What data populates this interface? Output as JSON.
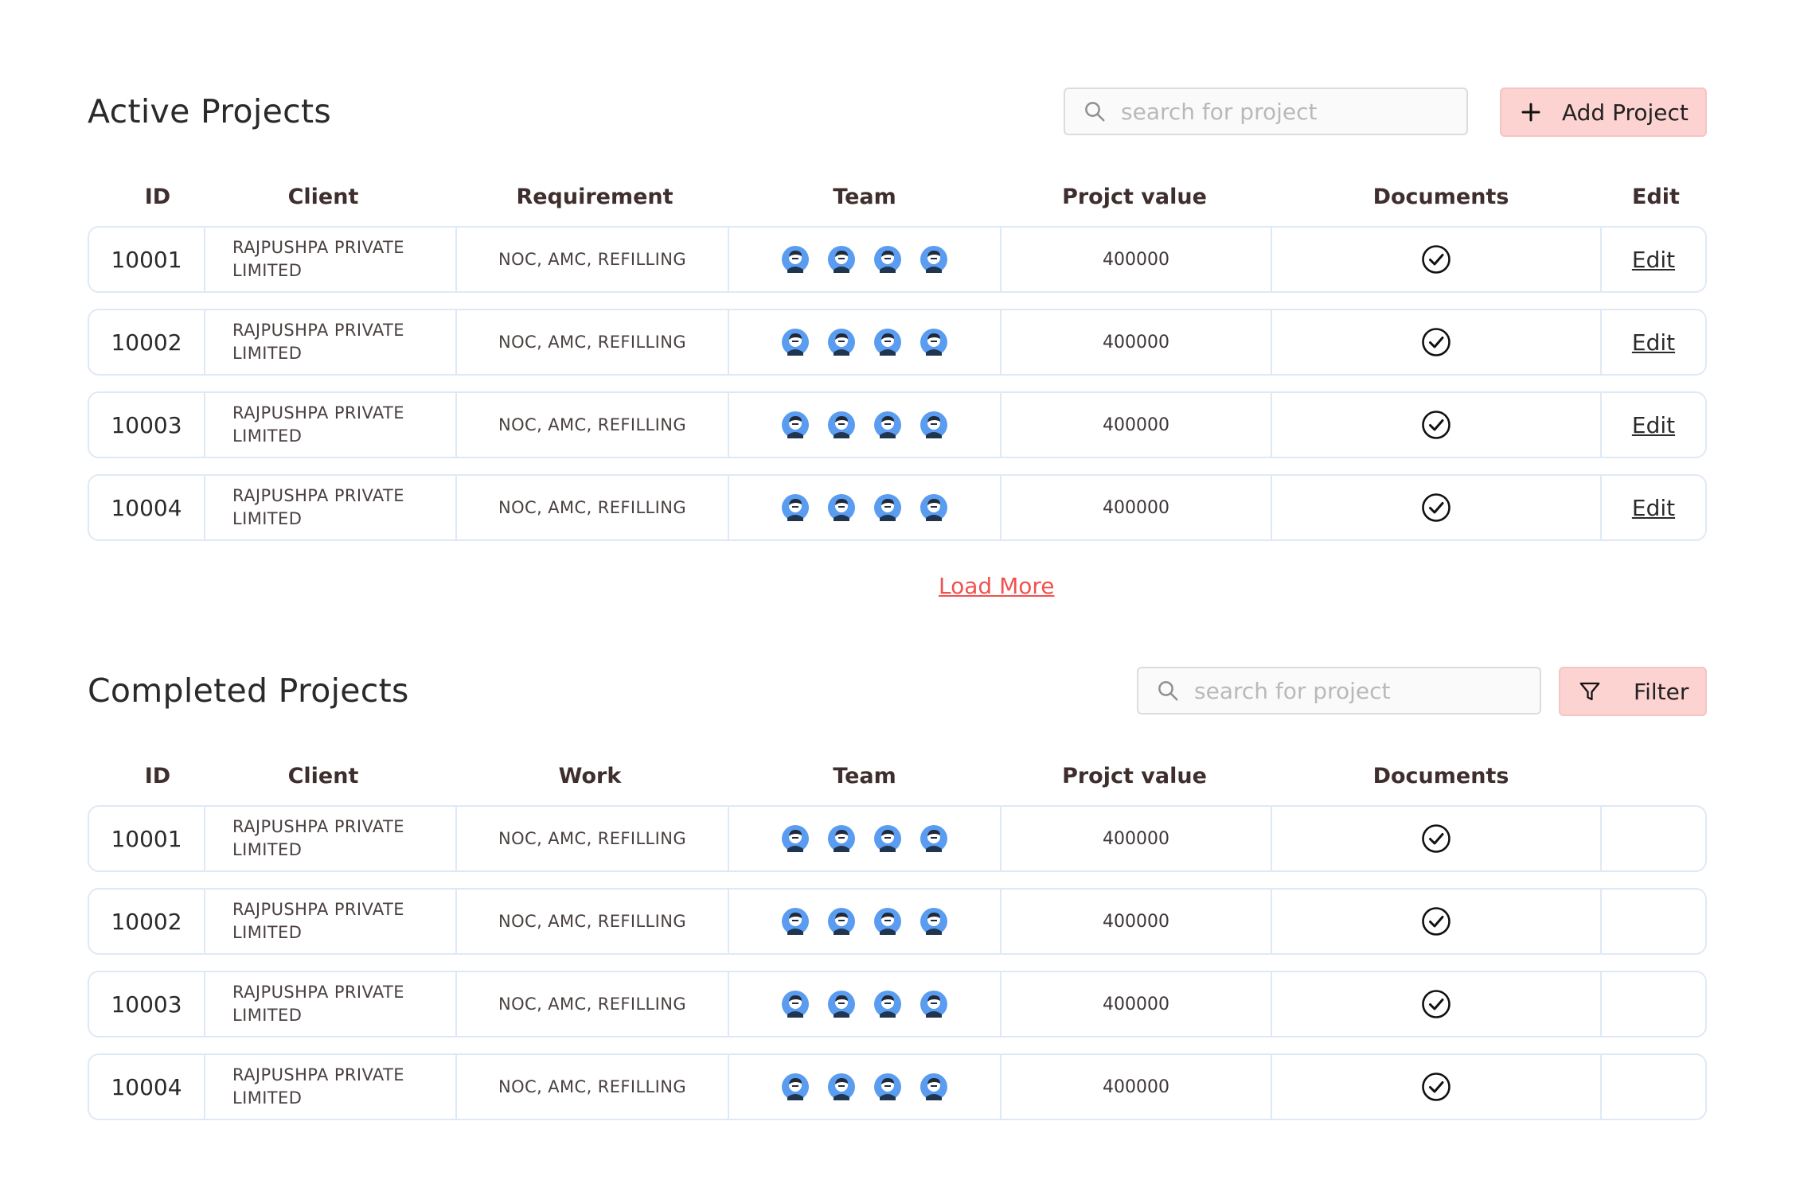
{
  "active_projects": {
    "title": "Active Projects",
    "search_placeholder": "search for project",
    "add_button_label": "Add Project",
    "columns": {
      "id": "ID",
      "client": "Client",
      "requirement": "Requirement",
      "team": "Team",
      "value": "Projct value",
      "documents": "Documents",
      "edit": "Edit"
    },
    "rows": [
      {
        "id": "10001",
        "client": "RAJPUSHPA PRIVATE LIMITED",
        "requirement": "NOC, AMC, REFILLING",
        "value": "400000",
        "edit": "Edit"
      },
      {
        "id": "10002",
        "client": "RAJPUSHPA PRIVATE LIMITED",
        "requirement": "NOC, AMC, REFILLING",
        "value": "400000",
        "edit": "Edit"
      },
      {
        "id": "10003",
        "client": "RAJPUSHPA PRIVATE LIMITED",
        "requirement": "NOC, AMC, REFILLING",
        "value": "400000",
        "edit": "Edit"
      },
      {
        "id": "10004",
        "client": "RAJPUSHPA PRIVATE LIMITED",
        "requirement": "NOC, AMC, REFILLING",
        "value": "400000",
        "edit": "Edit"
      }
    ],
    "load_more_label": "Load More"
  },
  "completed_projects": {
    "title": "Completed Projects",
    "search_placeholder": "search for project",
    "filter_button_label": "Filter",
    "columns": {
      "id": "ID",
      "client": "Client",
      "work": "Work",
      "team": "Team",
      "value": "Projct value",
      "documents": "Documents"
    },
    "rows": [
      {
        "id": "10001",
        "client": "RAJPUSHPA PRIVATE LIMITED",
        "work": "NOC, AMC, REFILLING",
        "value": "400000"
      },
      {
        "id": "10002",
        "client": "RAJPUSHPA PRIVATE LIMITED",
        "work": "NOC, AMC, REFILLING",
        "value": "400000"
      },
      {
        "id": "10003",
        "client": "RAJPUSHPA PRIVATE LIMITED",
        "work": "NOC, AMC, REFILLING",
        "value": "400000"
      },
      {
        "id": "10004",
        "client": "RAJPUSHPA PRIVATE LIMITED",
        "work": "NOC, AMC, REFILLING",
        "value": "400000"
      }
    ]
  },
  "icons": {
    "search": "search-icon",
    "add": "plus-icon",
    "filter": "filter-icon",
    "team_member": "avatar-icon",
    "documents": "check-circle-icon"
  },
  "colors": {
    "accent_button_bg": "#fcd3d1",
    "load_more_link": "#f0524f",
    "row_border": "#dfe9f6",
    "avatar": "#5a9cf0",
    "header_text": "#3f2e2e"
  }
}
